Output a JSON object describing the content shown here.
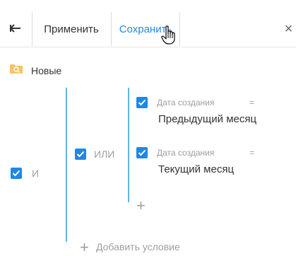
{
  "toolbar": {
    "back_icon": "arrow-left-icon",
    "apply_label": "Применить",
    "save_label": "Сохранить",
    "close_glyph": "×",
    "accent": "#1e88e5"
  },
  "folder": {
    "icon": "folder-search-icon",
    "label": "Новые"
  },
  "groups": {
    "root_operator": "И",
    "nested_operator": "ИЛИ",
    "line_color": "#5eb6e4"
  },
  "conditions": [
    {
      "field": "Дата создания",
      "operator": "=",
      "value": "Предыдущий месяц"
    },
    {
      "field": "Дата создания",
      "operator": "=",
      "value": "Текущий месяц"
    }
  ],
  "add_condition_label": "Добавить условие",
  "plus_glyph": "+"
}
